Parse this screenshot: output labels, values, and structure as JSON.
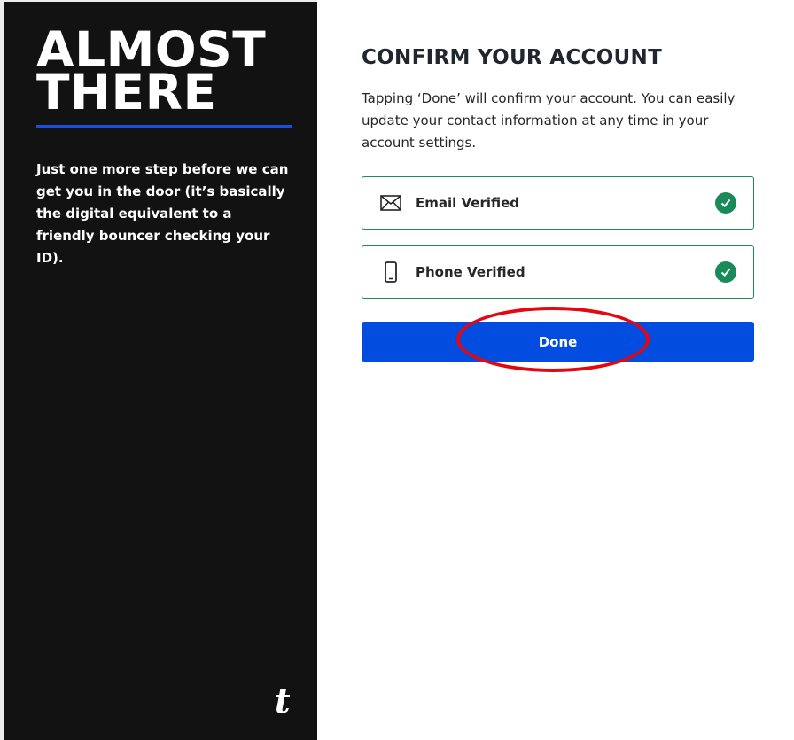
{
  "sidebar": {
    "headline_line1": "ALMOST",
    "headline_line2": "THERE",
    "description": "Just one more step before we can get you in the door (it’s basically the digital equivalent to a friendly bouncer checking your ID).",
    "logo": "t"
  },
  "main": {
    "title": "CONFIRM YOUR ACCOUNT",
    "description": "Tapping ‘Done’ will confirm your account. You can easily update your contact information at any time in your account settings.",
    "email_card": {
      "icon": "envelope-icon",
      "label": "Email Verified",
      "status_icon": "check-circle-icon"
    },
    "phone_card": {
      "icon": "phone-icon",
      "label": "Phone Verified",
      "status_icon": "check-circle-icon"
    },
    "done_label": "Done"
  },
  "colors": {
    "sidebar_bg": "#121212",
    "accent_blue": "#024ddf",
    "verified_green": "#1b8a5a",
    "annotation_red": "#e3070f"
  }
}
